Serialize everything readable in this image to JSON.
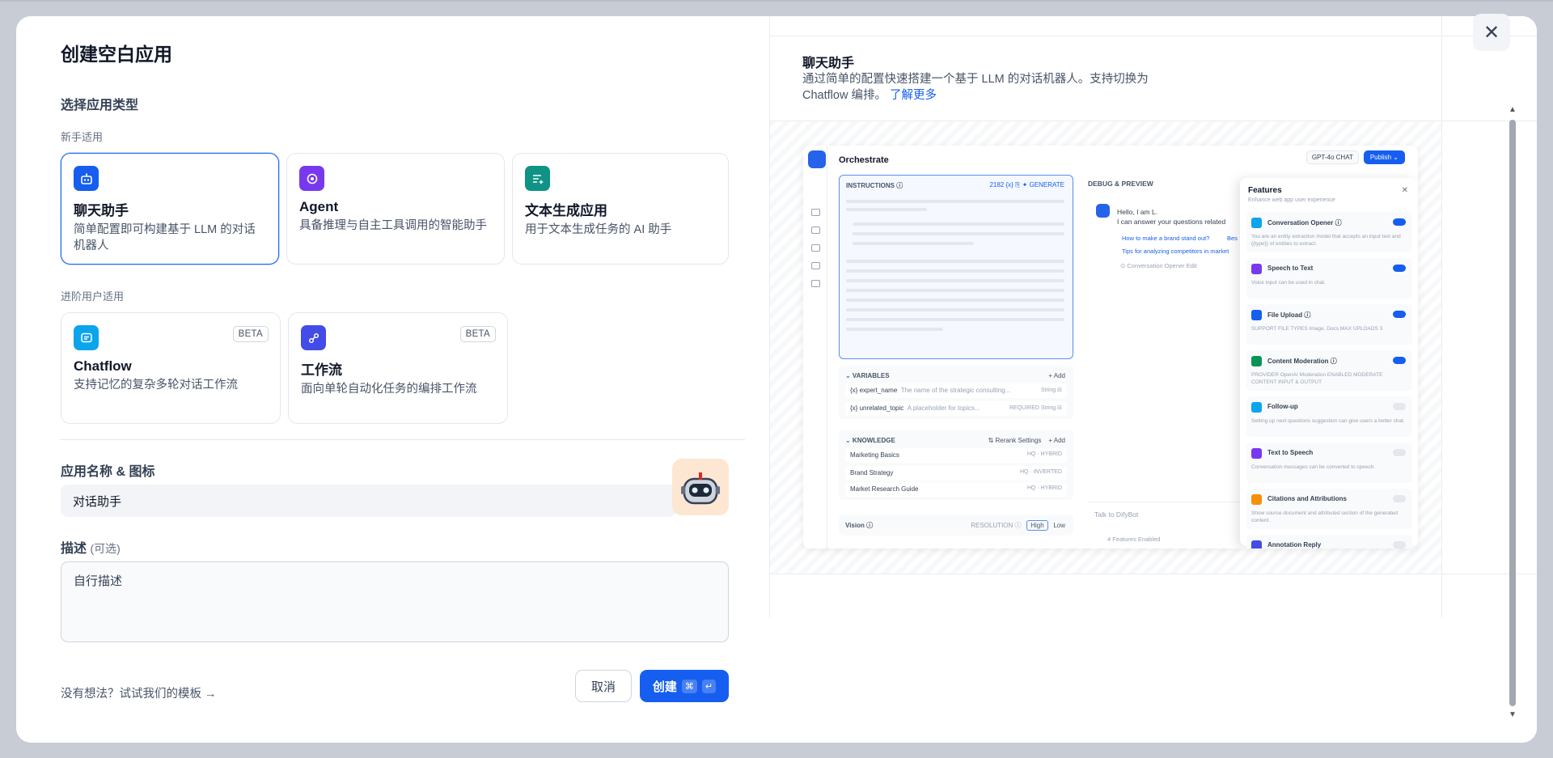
{
  "modal": {
    "title": "创建空白应用",
    "section_title": "选择应用类型",
    "beginner_label": "新手适用",
    "advanced_label": "进阶用户适用",
    "app_types": [
      {
        "name": "聊天助手",
        "desc": "简单配置即可构建基于 LLM 的对话机器人",
        "icon": "chat-bot-icon",
        "color": "#155eef",
        "selected": true
      },
      {
        "name": "Agent",
        "desc": "具备推理与自主工具调用的智能助手",
        "icon": "agent-icon",
        "color": "#7839ee",
        "selected": false
      },
      {
        "name": "文本生成应用",
        "desc": "用于文本生成任务的 AI 助手",
        "icon": "text-generate-icon",
        "color": "#0e9384",
        "selected": false
      }
    ],
    "advanced_types": [
      {
        "name": "Chatflow",
        "desc": "支持记忆的复杂多轮对话工作流",
        "badge": "BETA",
        "icon": "chatflow-icon",
        "color": "#0ba5ec"
      },
      {
        "name": "工作流",
        "desc": "面向单轮自动化任务的编排工作流",
        "badge": "BETA",
        "icon": "workflow-icon",
        "color": "#444ce7"
      }
    ],
    "name_label": "应用名称 & 图标",
    "name_value": "对话助手",
    "desc_label": "描述",
    "desc_optional": "(可选)",
    "desc_placeholder": "自行描述",
    "template_link": "没有想法？试试我们的模板 →",
    "cancel_label": "取消",
    "create_label": "创建",
    "create_kbd_1": "⌘",
    "create_kbd_2": "↵"
  },
  "preview": {
    "title": "聊天助手",
    "desc": "通过简单的配置快速搭建一个基于 LLM 的对话机器人。支持切换为 Chatflow 编排。",
    "learn_more": "了解更多",
    "close_icon": "close-icon",
    "mini": {
      "orchestrate": "Orchestrate",
      "model": "GPT-4o",
      "model_tag": "CHAT",
      "publish": "Publish ⌄",
      "instructions": "INSTRUCTIONS ⓘ",
      "instr_meta": "2182   {x}   ⎘   ✦ GENERATE",
      "variables": "⌄ VARIABLES",
      "add": "+ Add",
      "var_rows": [
        {
          "name": "{x} expert_name",
          "desc": "The name of the strategic consulting...",
          "tag": "String ⊟"
        },
        {
          "name": "{x} unrelated_topic",
          "desc": "A placeholder for topics...",
          "tag": "REQUIRED   String ⊟"
        }
      ],
      "knowledge": "⌄ KNOWLEDGE",
      "rerank": "⇅ Rerank Settings",
      "knowledge_rows": [
        {
          "name": "Marketing Basics",
          "tag": "HQ · HYBRID"
        },
        {
          "name": "Brand Strategy",
          "tag": "HQ · INVERTED"
        },
        {
          "name": "Market Research Guide",
          "tag": "HQ · HYBRID"
        }
      ],
      "vision": "Vision ⓘ",
      "resolution": "RESOLUTION ⓘ",
      "high": "High",
      "low": "Low",
      "debug": "DEBUG & PREVIEW",
      "chat_hello": "Hello, I am L.",
      "chat_line2": "I can answer your questions related",
      "chat_link1": "How to make a brand stand out?",
      "chat_link1b": "Bes",
      "chat_link2": "Tips for analyzing competitors in market",
      "opener_note": "⊙ Conversation Opener   Edit",
      "talk": "Talk to DifyBot",
      "features_enabled": "4 Features Enabled",
      "features_title": "Features",
      "features_sub": "Enhance web app user experience",
      "features": [
        {
          "name": "Conversation Opener ⓘ",
          "desc": "You are an entity extraction model that accepts an input text and {{type}} of entities to extract.",
          "on": true,
          "color": "#0ba5ec"
        },
        {
          "name": "Speech to Text",
          "desc": "Voice input can be used in chat.",
          "on": true,
          "color": "#7839ee"
        },
        {
          "name": "File Upload ⓘ",
          "desc": "SUPPORT FILE TYPES  Image, Docs     MAX UPLOADS  3",
          "on": true,
          "color": "#155eef"
        },
        {
          "name": "Content Moderation ⓘ",
          "desc": "PROVIDER  OpenAI Moderation     ENABLED MODERATE CONTENT  INPUT & OUTPUT",
          "on": true,
          "color": "#079455"
        },
        {
          "name": "Follow-up",
          "desc": "Setting up next questions suggestion can give users a better chat.",
          "on": false,
          "color": "#0ba5ec"
        },
        {
          "name": "Text to Speech",
          "desc": "Conversation messages can be converted to speech.",
          "on": false,
          "color": "#7839ee"
        },
        {
          "name": "Citations and Attributions",
          "desc": "Show source document and attributed section of the generated content.",
          "on": false,
          "color": "#f79009"
        },
        {
          "name": "Annotation Reply",
          "desc": "",
          "on": false,
          "color": "#444ce7"
        }
      ]
    }
  }
}
